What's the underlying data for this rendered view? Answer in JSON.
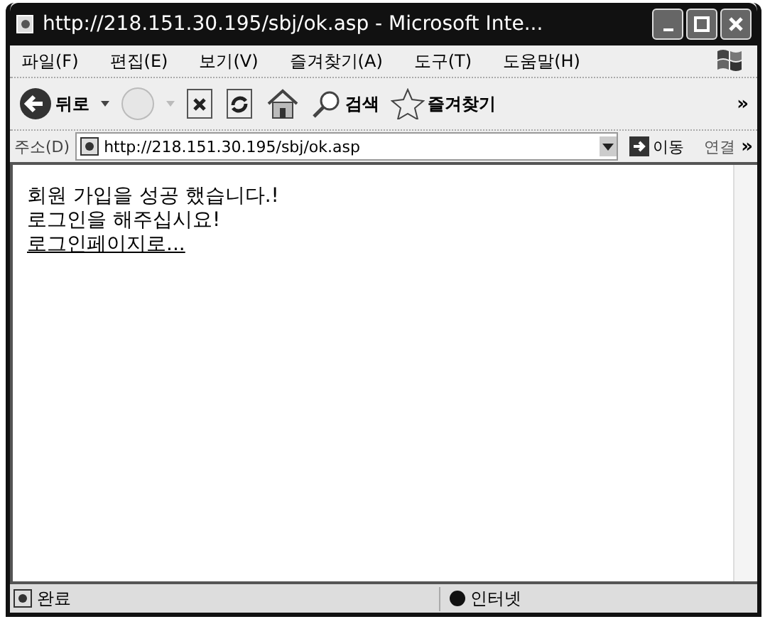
{
  "window": {
    "title": "http://218.151.30.195/sbj/ok.asp - Microsoft Inte..."
  },
  "menu": [
    {
      "label": "파일(F)"
    },
    {
      "label": "편집(E)"
    },
    {
      "label": "보기(V)"
    },
    {
      "label": "즐겨찾기(A)"
    },
    {
      "label": "도구(T)"
    },
    {
      "label": "도움말(H)"
    }
  ],
  "toolbar": {
    "back": "뒤로",
    "search": "검색",
    "favorites": "즐겨찾기",
    "overflow": "»"
  },
  "address_bar": {
    "label": "주소(D)",
    "value": "http://218.151.30.195/sbj/ok.asp",
    "go": "이동",
    "links": "연결",
    "overflow": "»"
  },
  "content": {
    "lines": [
      {
        "kind": "text",
        "text": "회원 가입을 성공 했습니다.!"
      },
      {
        "kind": "text",
        "text": "로그인을 해주십시요!"
      },
      {
        "kind": "link",
        "text": "로그인페이지로..."
      }
    ]
  },
  "status_bar": {
    "status": "완료",
    "zone": "인터넷"
  }
}
